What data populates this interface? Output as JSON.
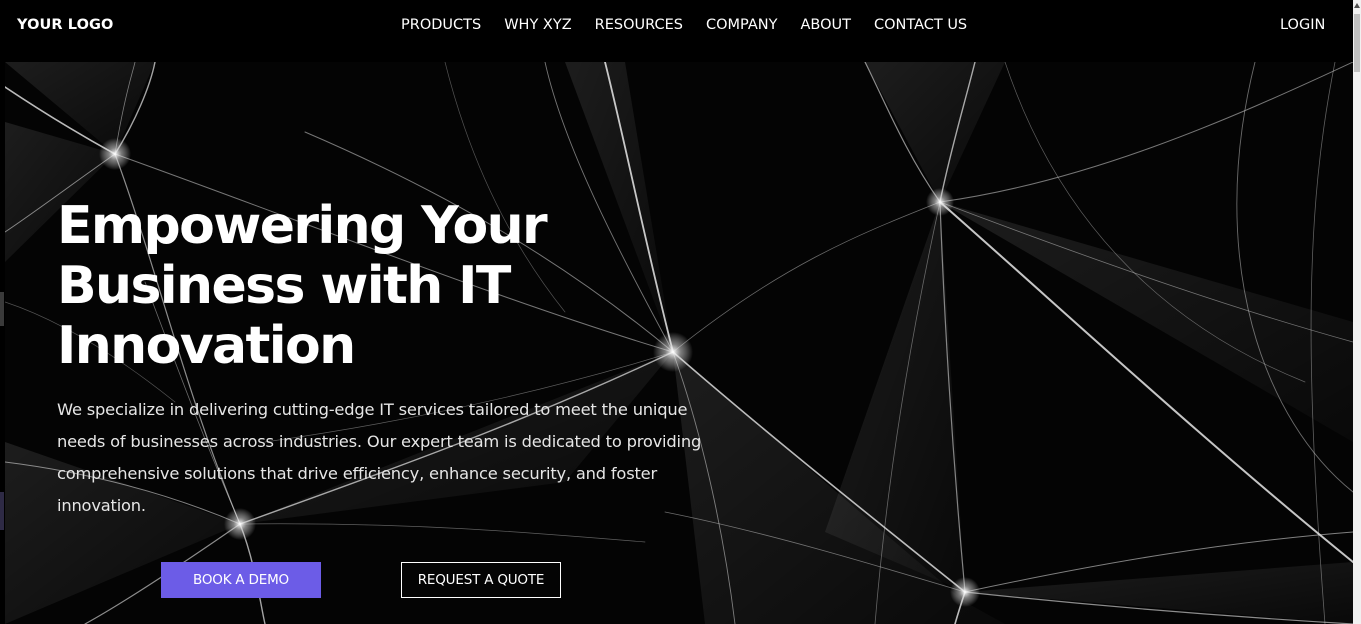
{
  "nav": {
    "logo": "YOUR LOGO",
    "links": [
      "PRODUCTS",
      "WHY XYZ",
      "RESOURCES",
      "COMPANY",
      "ABOUT",
      "CONTACT US"
    ],
    "login": "LOGIN"
  },
  "hero": {
    "title_lines": [
      "Empowering Your",
      "Business with IT",
      "Innovation"
    ],
    "description": "We specialize in delivering cutting-edge IT services tailored to meet the unique needs of businesses across industries. Our expert team is dedicated to providing comprehensive solutions that drive efficiency, enhance security, and foster innovation.",
    "primary_button": "BOOK A DEMO",
    "secondary_button": "REQUEST A QUOTE"
  },
  "colors": {
    "background": "#000000",
    "accent": "#6c5ce7",
    "text": "#ffffff"
  }
}
